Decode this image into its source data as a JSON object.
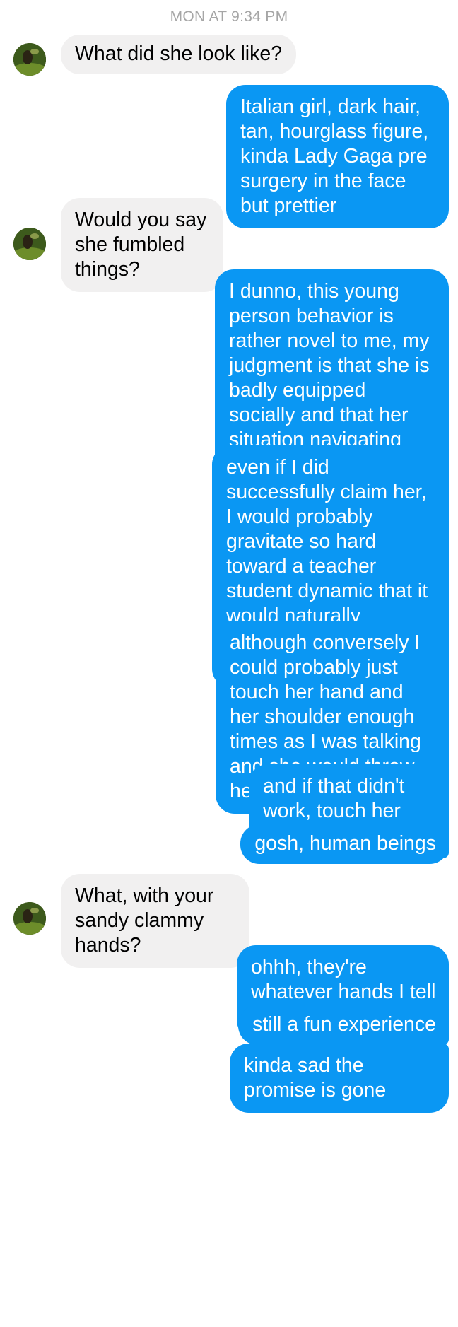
{
  "timestamp": "MON AT 9:34 PM",
  "messages": [
    {
      "text": "What did she look like?"
    },
    {
      "text": "Italian girl, dark hair, tan, hourglass figure, kinda Lady Gaga pre surgery in the face but prettier"
    },
    {
      "text": "Would you say she fumbled things?"
    },
    {
      "text": "I dunno, this young person behavior is rather novel to me, my judgment is that she is badly equipped socially and that her situation navigating tools are also very bad"
    },
    {
      "text": "even if I did successfully claim her, I would probably gravitate so hard toward a teacher student dynamic that it would naturally conclude itself after the first encounter anyway"
    },
    {
      "text": "although conversely I could probably just touch her hand and her shoulder enough times as I was talking and she would throw her pussy at me"
    },
    {
      "text": "and if that didn't work, touch her face"
    },
    {
      "text": "gosh, human beings"
    },
    {
      "text": "What, with your sandy clammy hands?"
    },
    {
      "text": "ohhh, they're whatever hands I tell you they are"
    },
    {
      "text": "still a fun experience"
    },
    {
      "text": "kinda sad the promise is gone"
    }
  ],
  "colors": {
    "incoming_bubble": "#f1f0f0",
    "outgoing_bubble": "#0a97f3",
    "timestamp": "#a6a6a6"
  },
  "icons": {
    "avatar": "contact-avatar-photo"
  }
}
